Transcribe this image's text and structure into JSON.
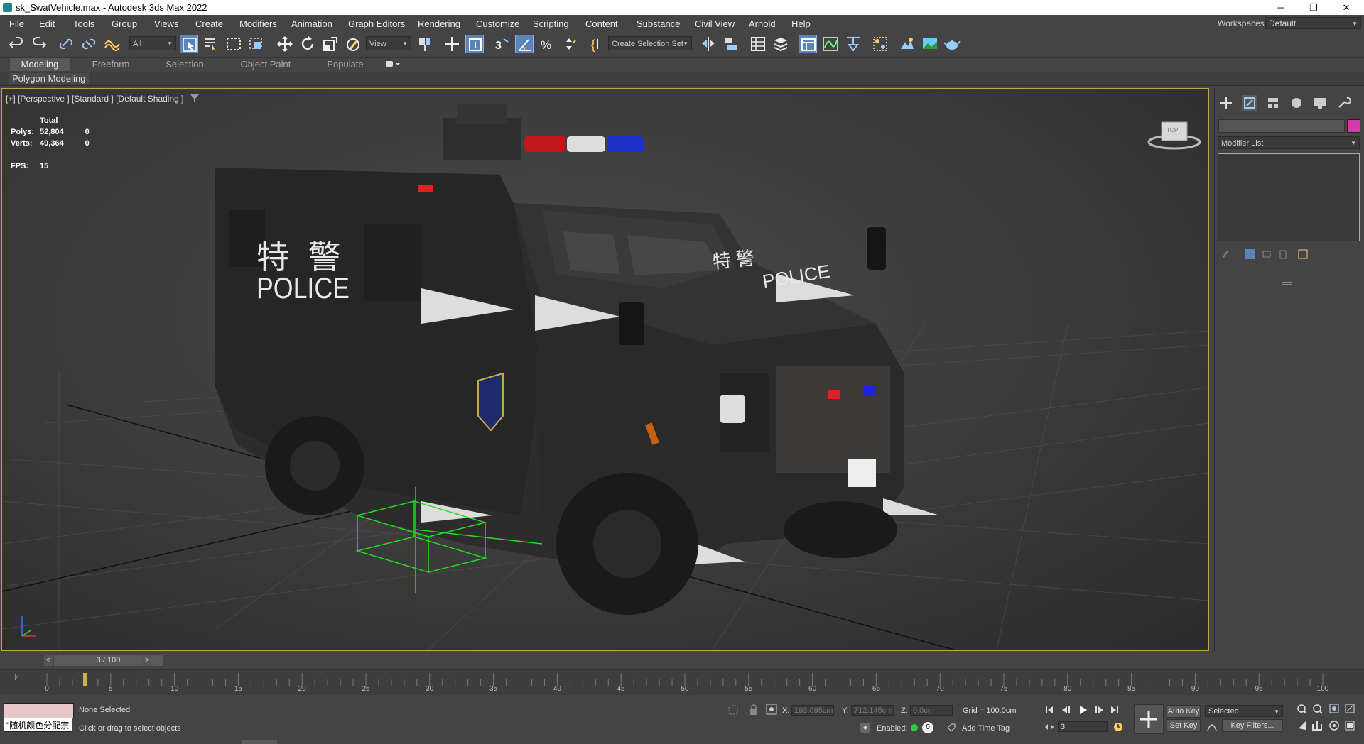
{
  "window": {
    "title": "sk_SwatVehicle.max - Autodesk 3ds Max 2022",
    "minimize": "─",
    "restore": "❐",
    "close": "✕"
  },
  "menu": [
    "File",
    "Edit",
    "Tools",
    "Group",
    "Views",
    "Create",
    "Modifiers",
    "Animation",
    "Graph Editors",
    "Rendering",
    "Customize",
    "Scripting",
    "Content",
    "Substance",
    "Civil View",
    "Arnold",
    "Help"
  ],
  "workspaces": {
    "label": "Workspaces:",
    "value": "Default"
  },
  "toolbar": {
    "selection_filter": "All",
    "ref_coord": "View",
    "named_selection": "Create Selection Set"
  },
  "ribbon": {
    "tabs": [
      "Modeling",
      "Freeform",
      "Selection",
      "Object Paint",
      "Populate"
    ],
    "active_tab": "Modeling",
    "sub_label": "Polygon Modeling"
  },
  "viewport": {
    "label": "[+] [Perspective ] [Standard ] [Default Shading ]",
    "stats": {
      "total_label": "Total",
      "polys_label": "Polys:",
      "polys_total": "52,804",
      "polys_sel": "0",
      "verts_label": "Verts:",
      "verts_total": "49,364",
      "verts_sel": "0",
      "fps_label": "FPS:",
      "fps": "15"
    },
    "vehicle_text_side_cn": "特 警",
    "vehicle_text_side": "POLICE",
    "vehicle_text_hood_cn": "特 警",
    "vehicle_text_hood": "POLICE",
    "viewcube_label": "TOP"
  },
  "command_panel": {
    "modifier_list": "Modifier List",
    "object_color": "#d63aa8"
  },
  "timeline": {
    "frame": "3 / 100",
    "prev": "<",
    "next": ">",
    "ticks": [
      "0",
      "5",
      "10",
      "15",
      "20",
      "25",
      "30",
      "35",
      "40",
      "45",
      "50",
      "55",
      "60",
      "65",
      "70",
      "75",
      "80",
      "85",
      "90",
      "95",
      "100"
    ]
  },
  "status": {
    "selection": "None Selected",
    "prompt": "Click or drag to select objects",
    "maxscript_text": "\"随机颜色分配宗",
    "x_label": "X:",
    "x_value": "193.095cm",
    "y_label": "Y:",
    "y_value": "712.145cm",
    "z_label": "Z:",
    "z_value": "0.0cm",
    "grid": "Grid = 100.0cm",
    "enabled_label": "Enabled:",
    "enabled_value": "0",
    "add_time_tag": "Add Time Tag",
    "auto_key": "Auto Key",
    "set_key": "Set Key",
    "key_mode": "Selected",
    "key_filters": "Key Filters...",
    "current_frame": "3"
  }
}
